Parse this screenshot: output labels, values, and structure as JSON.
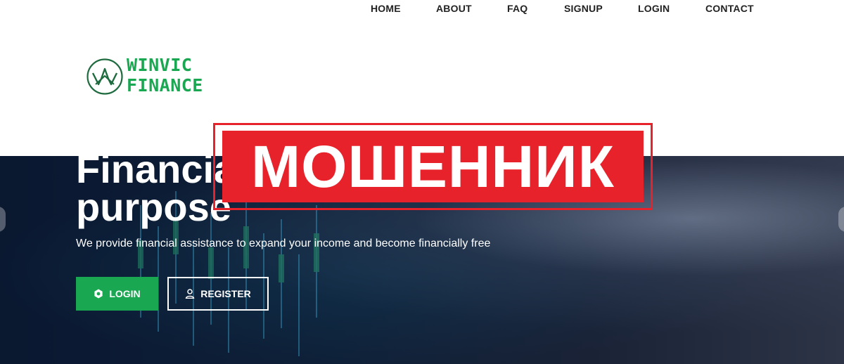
{
  "nav": {
    "items": [
      "HOME",
      "ABOUT",
      "FAQ",
      "SIGNUP",
      "LOGIN",
      "CONTACT"
    ]
  },
  "logo": {
    "line1": "WINVIC",
    "line2": "FINANCE",
    "color": "#1aa752"
  },
  "hero": {
    "title_line1": "Financial freedom is the",
    "title_line2": "purpose",
    "subtitle": "We provide financial assistance to expand your income and become financially free",
    "login_button": "LOGIN",
    "register_button": "REGISTER",
    "accent_color": "#1aa752"
  },
  "stamp": {
    "text": "МОШЕННИК",
    "color": "#e8222a"
  }
}
